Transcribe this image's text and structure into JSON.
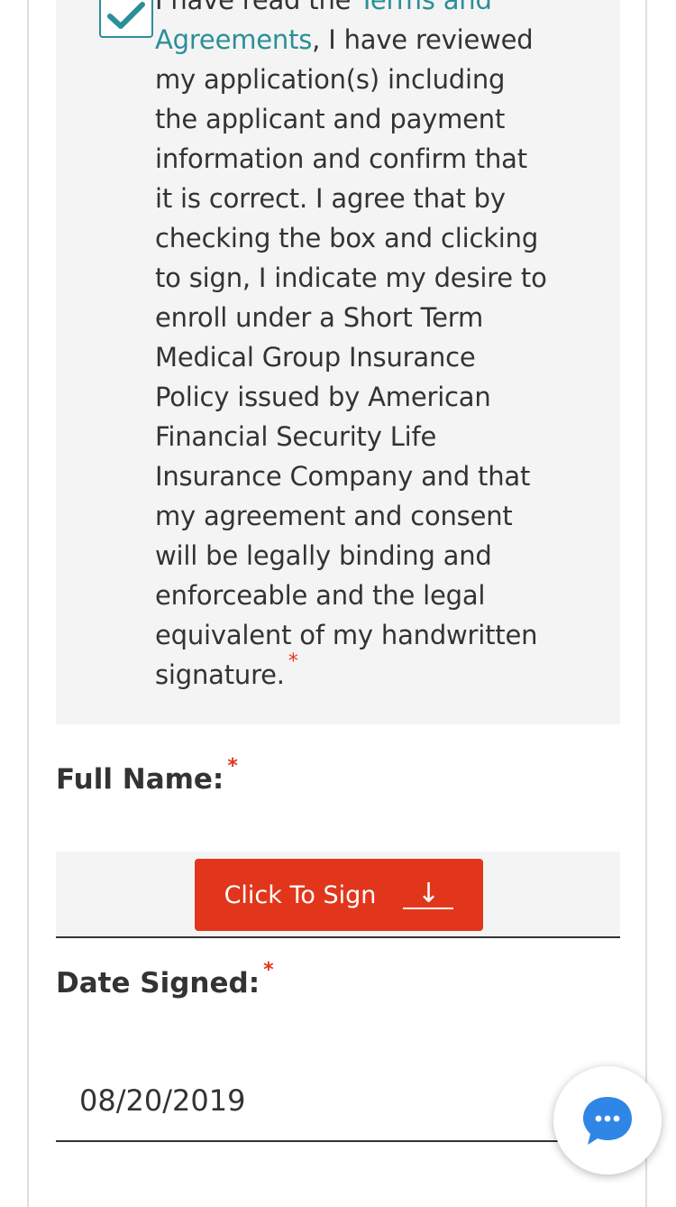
{
  "consent": {
    "checked": true,
    "text_before_link": "I have read the ",
    "link_text": "Terms and Agreements",
    "text_after_link": ", I have reviewed my application(s) including the applicant and payment information and confirm that it is correct. I agree that by checking the box and clicking to sign, I indicate my desire to enroll under a Short Term Medical Group Insurance Policy issued by American Financial Security Life Insurance Company and that my agreement and consent will be legally binding and enforceable and the legal equivalent of my handwritten signature.",
    "required_mark": "*"
  },
  "full_name": {
    "label": "Full Name:",
    "required_mark": "*",
    "sign_button_label": "Click To Sign",
    "sign_button_arrow": "↓"
  },
  "date_signed": {
    "label": "Date Signed:",
    "required_mark": "*",
    "value": "08/20/2019"
  },
  "chat": {
    "icon": "chat-bubble-icon"
  },
  "colors": {
    "accent": "#2a8f98",
    "required": "#e1361b",
    "button_bg": "#e1361b",
    "panel_bg": "#f4f4f4"
  }
}
